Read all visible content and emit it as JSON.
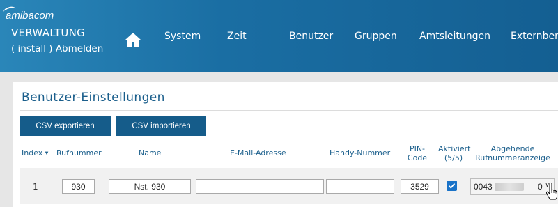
{
  "header": {
    "logo": "amibacom",
    "app_title": "VERWALTUNG",
    "logout": "( install ) Abmelden",
    "nav": [
      "System",
      "Zeit",
      "Benutzer",
      "Gruppen",
      "Amtsleitungen",
      "Externber"
    ]
  },
  "page": {
    "title": "Benutzer-Einstellungen",
    "buttons": {
      "export": "CSV exportieren",
      "import": "CSV importieren"
    }
  },
  "table": {
    "columns": {
      "index": "Index",
      "sort_icon": "▼",
      "number": "Rufnummer",
      "name": "Name",
      "email": "E-Mail-Adresse",
      "mobile": "Handy-Nummer",
      "pin_l1": "PIN-",
      "pin_l2": "Code",
      "active_l1": "Aktiviert",
      "active_l2": "(5/5)",
      "outgoing_l1": "Abgehende",
      "outgoing_l2": "Rufnummeranzeige"
    },
    "rows": [
      {
        "index": "1",
        "number": "930",
        "name": "Nst. 930",
        "email": "",
        "mobile": "",
        "pin": "3529",
        "active": true,
        "outgoing_prefix": "0043",
        "outgoing_suffix": "0"
      }
    ]
  },
  "colors": {
    "header": "#1a6ea3",
    "button": "#155c8a",
    "title": "#1b5f8c",
    "checkbox": "#1a73c8"
  },
  "icons": {
    "home": "home-icon",
    "check": "check-icon",
    "chevron": "chevron-down-icon",
    "cursor": "hand-pointer-icon"
  }
}
